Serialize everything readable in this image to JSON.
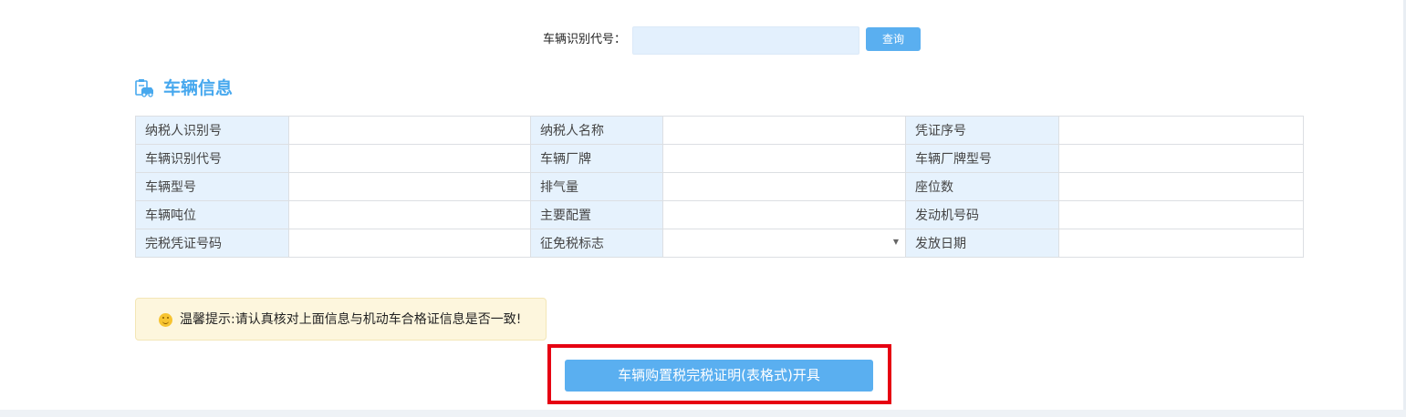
{
  "query": {
    "label": "车辆识别代号：",
    "input_value": "",
    "button_label": "查询"
  },
  "section": {
    "icon": "vehicle-doc-icon",
    "title": "车辆信息"
  },
  "table": {
    "rows": [
      [
        {
          "label": "纳税人识别号",
          "value": ""
        },
        {
          "label": "纳税人名称",
          "value": ""
        },
        {
          "label": "凭证序号",
          "value": ""
        }
      ],
      [
        {
          "label": "车辆识别代号",
          "value": ""
        },
        {
          "label": "车辆厂牌",
          "value": ""
        },
        {
          "label": "车辆厂牌型号",
          "value": ""
        }
      ],
      [
        {
          "label": "车辆型号",
          "value": ""
        },
        {
          "label": "排气量",
          "value": ""
        },
        {
          "label": "座位数",
          "value": ""
        }
      ],
      [
        {
          "label": "车辆吨位",
          "value": ""
        },
        {
          "label": "主要配置",
          "value": ""
        },
        {
          "label": "发动机号码",
          "value": ""
        }
      ],
      [
        {
          "label": "完税凭证号码",
          "value": ""
        },
        {
          "label": "征免税标志",
          "value": "",
          "select": true
        },
        {
          "label": "发放日期",
          "value": ""
        }
      ]
    ]
  },
  "tip": {
    "icon": "smile-icon",
    "text": "温馨提示:请认真核对上面信息与机动车合格证信息是否一致!"
  },
  "action": {
    "button_label": "车辆购置税完税证明(表格式)开具",
    "highlight_color": "#e60012"
  },
  "colors": {
    "accent": "#5aaff0",
    "title": "#47a8ee",
    "label_bg": "#e6f2fd",
    "tip_bg": "#fdf6dd"
  }
}
